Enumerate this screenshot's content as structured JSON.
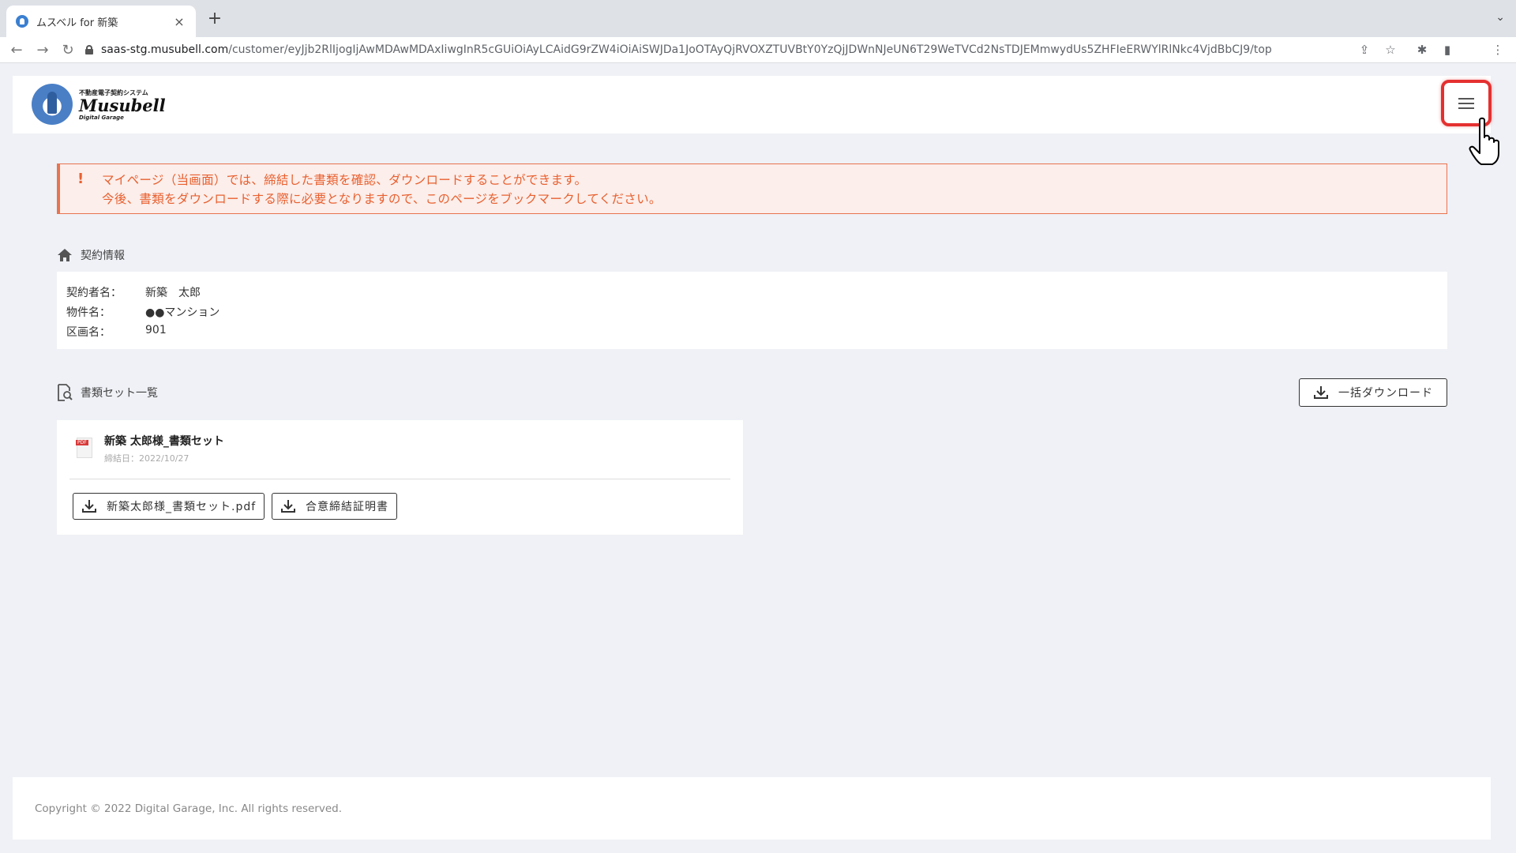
{
  "browser": {
    "tab_title": "ムスベル for 新築",
    "tab_close": "×",
    "new_tab": "+",
    "url_host": "saas-stg.musubell.com",
    "url_path": "/customer/eyJjb2RlIjogIjAwMDAwMDAxIiwgInR5cGUiOiAyLCAidG9rZW4iOiAiSWJDa1JoOTAyQjRVOXZTUVBtY0YzQjJDWnNJeUN6T29WeTVCd2NsTDJEMmwydUs5ZHFIeERWYlRlNkc4VjdBbCJ9/top"
  },
  "header": {
    "logo_sub": "不動産電子契約システム",
    "logo_main": "Musubell",
    "logo_dg": "Digital Garage"
  },
  "alert": {
    "icon": "!",
    "line1": "マイページ（当画面）では、締結した書類を確認、ダウンロードすることができます。",
    "line2": "今後、書類をダウンロードする際に必要となりますので、このページをブックマークしてください。"
  },
  "contract": {
    "heading": "契約情報",
    "rows": [
      {
        "label": "契約者名：",
        "value": "新築　太郎"
      },
      {
        "label": "物件名：",
        "value": "●●マンション"
      },
      {
        "label": "区画名：",
        "value": "901"
      }
    ]
  },
  "documents": {
    "heading": "書類セット一覧",
    "bulk_download": "一括ダウンロード",
    "set": {
      "title": "新築 太郎様_書類セット",
      "date": "締結日：2022/10/27",
      "buttons": [
        "新築太郎様_書類セット.pdf",
        "合意締結証明書"
      ]
    }
  },
  "footer": {
    "copyright": "Copyright © 2022 Digital Garage, Inc. All rights reserved."
  },
  "colors": {
    "accent_alert": "#e9602f",
    "highlight": "#e53030",
    "background": "#eff1f6"
  }
}
